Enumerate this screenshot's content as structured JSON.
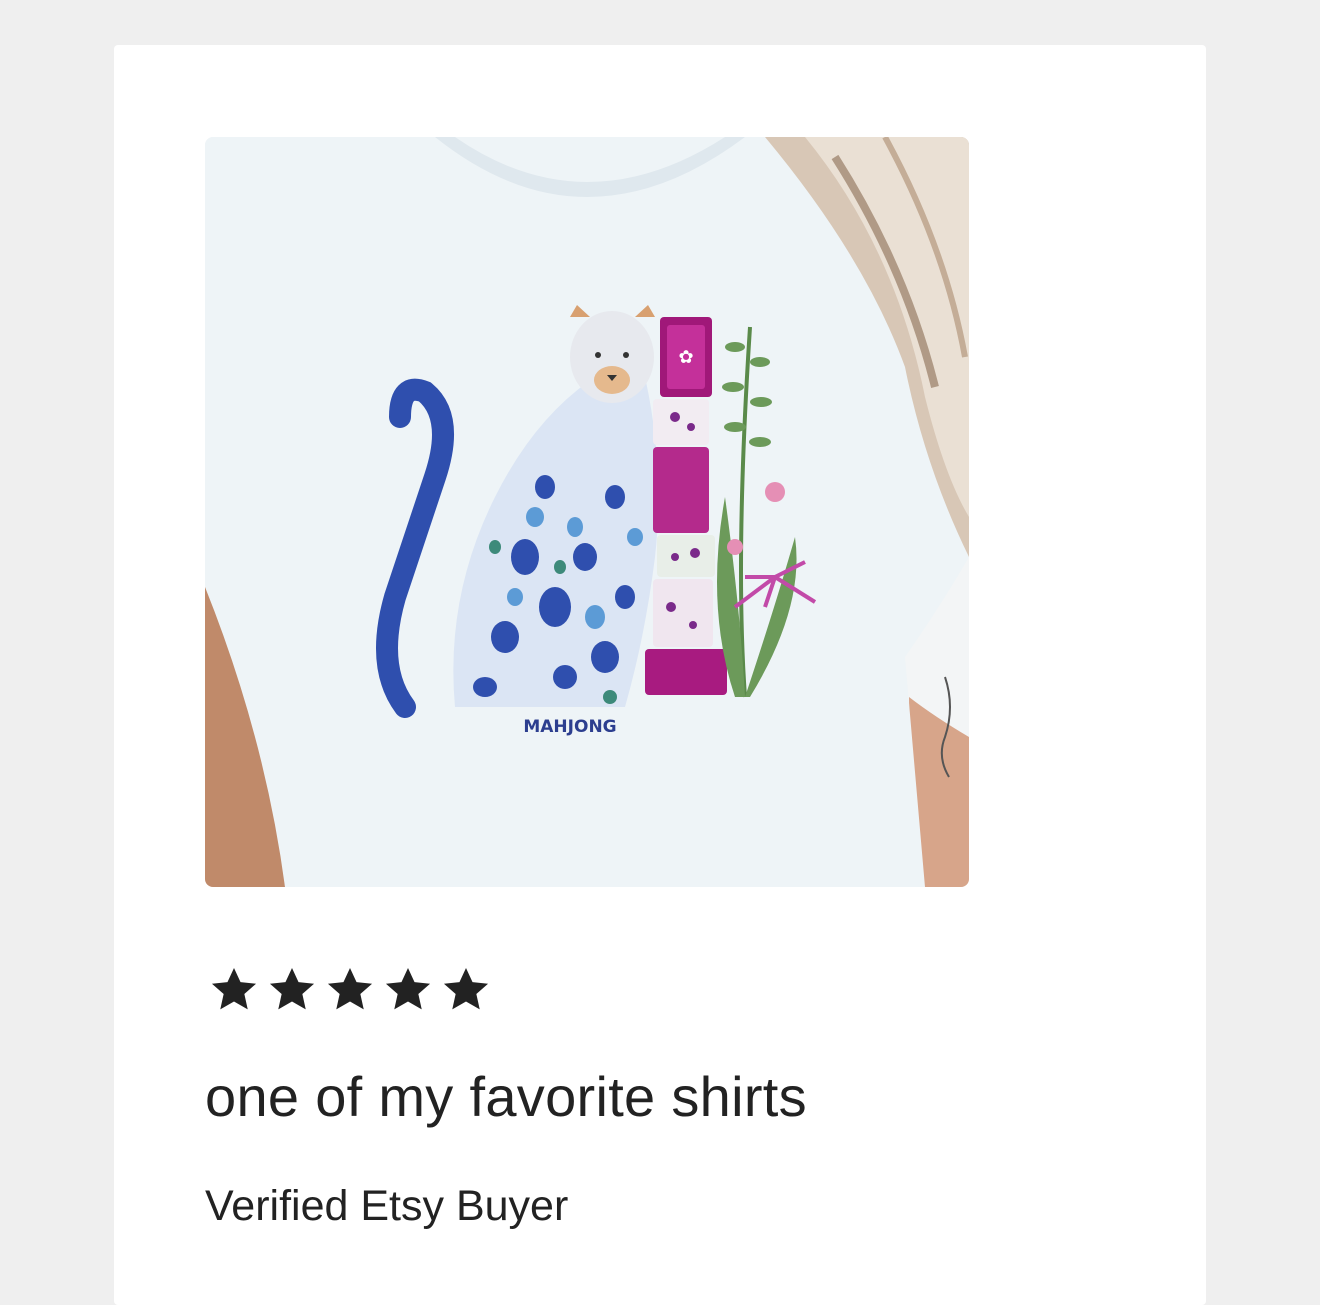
{
  "review": {
    "rating": 5,
    "rating_max": 5,
    "text": "one of my favorite shirts",
    "reviewer": "Verified Etsy Buyer"
  },
  "product_image": {
    "description_icon": "tshirt-photo",
    "print_caption": "MAHJONG"
  },
  "colors": {
    "page_background": "#efefef",
    "card_background": "#ffffff",
    "star": "#222222",
    "text": "#222222"
  }
}
